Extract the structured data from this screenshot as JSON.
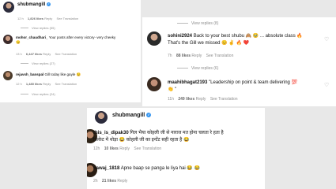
{
  "panel1": {
    "header_user": "shubmangill",
    "header_meta": {
      "time": "12 h",
      "likes": "1,826 likes",
      "reply": "Reply",
      "translate": "See Translation"
    },
    "view_replies_1": "View replies (55)",
    "comment2": {
      "user": "mohor_chaudhari_",
      "text": "Your posts after every victory- very cheeky",
      "emoji": "😏",
      "meta": {
        "time": "13 h",
        "likes": "6,447 likes",
        "reply": "Reply",
        "translate": "See Translation"
      }
    },
    "view_replies_2": "View replies (27)",
    "comment3": {
      "user": "rejavsh_banspal",
      "text": "Gill today like gayle",
      "emoji": "😉",
      "meta": {
        "time": "12 h",
        "likes": "1,480 likes",
        "reply": "Reply",
        "translate": "See Translation"
      }
    },
    "view_replies_3": "View replies (24)"
  },
  "panel2": {
    "view_replies_top": "View replies (8)",
    "comment1": {
      "user": "sohini2924",
      "text_line1": "Back to your best shubu 🙈 🥹 ... absolute class 🔥",
      "text_line2": "That's the Gill we missed 😊 ✌️ 🔥 ❤️",
      "meta": {
        "time": "7h",
        "likes": "88 likes",
        "reply": "Reply",
        "translate": "See Translation"
      }
    },
    "view_replies_mid": "View replies (6)",
    "comment2": {
      "user": "maahibhagat2193",
      "text_line1": "\"Leadership on point & team delivering 💯",
      "text_line2": "👏 \"",
      "meta": {
        "time": "11h",
        "likes": "249 likes",
        "reply": "Reply",
        "translate": "See Translation"
      }
    }
  },
  "panel3": {
    "header_user": "shubmangill",
    "comment1": {
      "user": "this_is_dipak30",
      "text_line1": "गिल भैया कोहली जी से नाराज मत होना चलता रे हता है",
      "text_line2": "क्रिकेट में थोड़ा 😂 कोहली जी का इन्टेंट सही रहता है 😂",
      "meta": {
        "time": "12h",
        "likes": "10 likes",
        "reply": "Reply",
        "translate": "See Translation"
      }
    },
    "comment2": {
      "user": "nawaj_1818",
      "text": "Apne baap se panga le liya hai 😂 😂",
      "meta": {
        "time": "2h",
        "likes": "21 likes",
        "reply": "Reply"
      }
    }
  }
}
